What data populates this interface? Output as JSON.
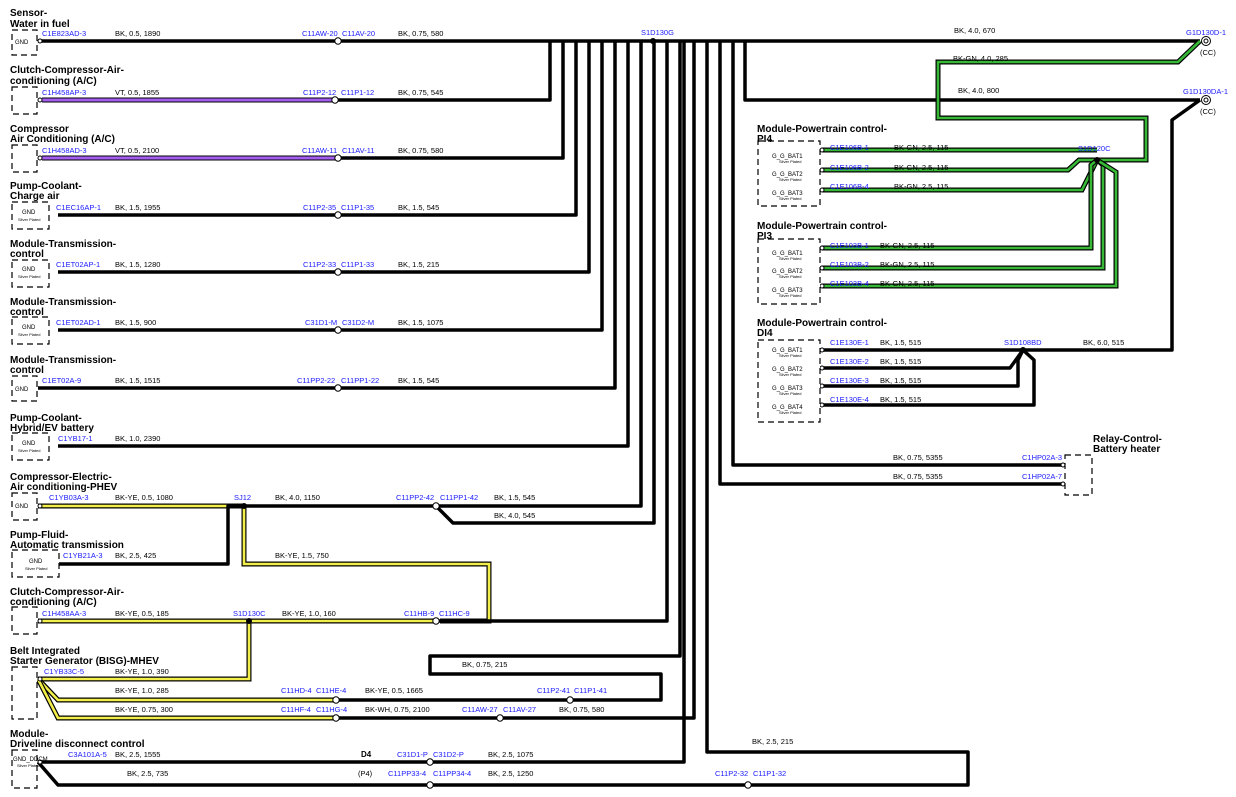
{
  "components": {
    "water_sensor": {
      "l1": "Sensor-",
      "l2": "Water in fuel",
      "ground": "GND",
      "ground_sub": ""
    },
    "clutch_ac_1": {
      "l1": "Clutch-Compressor-Air-",
      "l2": "conditioning (A/C)"
    },
    "compressor_ac": {
      "l1": "Compressor",
      "l2": "Air Conditioning (A/C)"
    },
    "pump_charge": {
      "l1": "Pump-Coolant-",
      "l2": "Charge air",
      "ground": "GND",
      "ground_sub": "Silver Plated"
    },
    "tcm_1": {
      "l1": "Module-Transmission-",
      "l2": "control",
      "ground": "GND",
      "ground_sub": "Silver Plated"
    },
    "tcm_2": {
      "l1": "Module-Transmission-",
      "l2": "control",
      "ground": "GND",
      "ground_sub": "Silver Plated"
    },
    "tcm_3": {
      "l1": "Module-Transmission-",
      "l2": "control",
      "ground": "GND",
      "ground_sub": ""
    },
    "pump_hybrid": {
      "l1": "Pump-Coolant-",
      "l2": "Hybrid/EV battery",
      "ground": "GND",
      "ground_sub": "Silver Plated"
    },
    "comp_phev": {
      "l1": "Compressor-Electric-",
      "l2": "Air conditioning-PHEV",
      "ground": "GND",
      "ground_sub": ""
    },
    "pump_fluid": {
      "l1": "Pump-Fluid-",
      "l2": "Automatic transmission",
      "ground": "GND",
      "ground_sub": "Silver Plated"
    },
    "clutch_ac_2": {
      "l1": "Clutch-Compressor-Air-",
      "l2": "conditioning (A/C)"
    },
    "bisg": {
      "l1": "Belt Integrated",
      "l2": "Starter Generator (BISG)-MHEV"
    },
    "ddcm": {
      "l1": "Module-",
      "l2": "Driveline disconnect control",
      "ground": "GND_DDCM",
      "ground_sub": "Silver Plated"
    },
    "pcm_pi4": {
      "l1": "Module-Powertrain control-",
      "l2": "PI4",
      "pins": [
        "G_G_BAT1",
        "G_G_BAT2",
        "G_G_BAT3"
      ],
      "sub": "Silver Plated"
    },
    "pcm_pi3": {
      "l1": "Module-Powertrain control-",
      "l2": "PI3",
      "pins": [
        "G_G_BAT1",
        "G_G_BAT2",
        "G_G_BAT3"
      ],
      "sub": "Silver Plated"
    },
    "pcm_di4": {
      "l1": "Module-Powertrain control-",
      "l2": "DI4",
      "pins": [
        "G_G_BAT1",
        "G_G_BAT2",
        "G_G_BAT3",
        "G_G_BAT4"
      ],
      "sub": "Silver Plated"
    },
    "relay": {
      "l1": "Relay-Control-",
      "l2": "Battery heater"
    }
  },
  "connectors": {
    "c_water": "C1E823AD-3",
    "c_clutch1": "C1H458AP-3",
    "c_comp": "C1H458AD-3",
    "c_pumpchg": "C1EC16AP-1",
    "c_tcm1": "C1ET02AP-1",
    "c_tcm2": "C1ET02AD-1",
    "c_tcm3": "C1ET02A-9",
    "c_pumphyb": "C1YB17-1",
    "c_phev": "C1YB03A-3",
    "c_fluid": "C1YB21A-3",
    "c_clutch2": "C1H458AA-3",
    "c_bisg": "C1YB33C-5",
    "c_ddcm": "C3A101A-5",
    "i1a": "C11AW-20",
    "i1b": "C11AV-20",
    "i2a": "C11P2-12",
    "i2b": "C11P1-12",
    "i3a": "C11AW-11",
    "i3b": "C11AV-11",
    "i4a": "C11P2-35",
    "i4b": "C11P1-35",
    "i5a": "C11P2-33",
    "i5b": "C11P1-33",
    "i6a": "C31D1-M",
    "i6b": "C31D2-M",
    "i7a": "C11PP2-22",
    "i7b": "C11PP1-22",
    "i9a": "C11PP2-42",
    "i9b": "C11PP1-42",
    "i11a": "C11HB-9",
    "i11b": "C11HC-9",
    "i12a": "C11HD-4",
    "i12b": "C11HE-4",
    "i12c": "C11P2-41",
    "i12d": "C11P1-41",
    "i13a": "C11HF-4",
    "i13b": "C11HG-4",
    "i13c": "C11AW-27",
    "i13d": "C11AV-27",
    "i14a": "C31D1-P",
    "i14b": "C31D2-P",
    "i15a": "C11PP33-4",
    "i15b": "C11PP34-4",
    "i16a": "C11P2-32",
    "i16b": "C11P1-32",
    "s1": "S1D130G",
    "sj12": "SJ12",
    "s130c": "S1D130C",
    "s120c": "S1D120C",
    "s108bd": "S1D108BD",
    "g1": "G1D130D-1",
    "g2": "G1D130DA-1",
    "cc": "(CC)",
    "pi4_1": "C1E106B-1",
    "pi4_2": "C1E106B-2",
    "pi4_3": "C1E106B-4",
    "pi3_1": "C1E103B-1",
    "pi3_2": "C1E103B-2",
    "pi3_3": "C1E103B-4",
    "di4_1": "C1E130E-1",
    "di4_2": "C1E130E-2",
    "di4_3": "C1E130E-3",
    "di4_4": "C1E130E-4",
    "relay_a": "C1HP02A-3",
    "relay_b": "C1HP02A-7"
  },
  "wires": {
    "w1a": "BK,  0.5,  1890",
    "w1b": "BK,  0.75,  580",
    "w2a": "VT,  0.5,  1855",
    "w2b": "BK,  0.75,  545",
    "w3a": "VT,  0.5,  2100",
    "w3b": "BK,  0.75,  580",
    "w4a": "BK,  1.5,  1955",
    "w4b": "BK,  1.5,  545",
    "w5a": "BK,  1.5,  1280",
    "w5b": "BK,  1.5,  215",
    "w6a": "BK,  1.5,  900",
    "w6b": "BK,  1.5,  1075",
    "w7a": "BK,  1.5,  1515",
    "w7b": "BK,  1.5,  545",
    "w8a": "BK,  1.0,  2390",
    "w9a": "BK-YE,  0.5,  1080",
    "w9b": "BK,  4.0,  1150",
    "w9c": "BK,  1.5,  545",
    "w9d": "BK,  4.0,  545",
    "w10a": "BK,  2.5,  425",
    "w10b": "BK-YE,  1.5,  750",
    "w11a": "BK-YE,  0.5,  185",
    "w11b": "BK-YE,  1.0,  160",
    "w12a": "BK-YE,  1.0,  390",
    "w12b": "BK-YE,  1.0,  285",
    "w12c": "BK-YE,  0.5,  1665",
    "w12d": "BK,  0.75,  215",
    "w13a": "BK-YE,  0.75,  300",
    "w13b": "BK-WH,  0.75,  2100",
    "w13c": "BK,  0.75,  580",
    "w14a": "BK,  2.5,  1555",
    "w14b": "BK,  2.5,  1075",
    "w15a": "BK,  2.5,  735",
    "w15b": "BK,  2.5,  1250",
    "w16": "BK,  2.5,  215",
    "wg1": "BK,  4.0,  670",
    "wg2": "BK-GN,  4.0,  285",
    "wg3": "BK,  4.0,  800",
    "wpi4": "BK-GN,  2.5,  115",
    "wpi3": "BK-GN,  2.5,  115",
    "wdi4": "BK,  1.5,  515",
    "wdi4b": "BK,  6.0,  515",
    "wr1": "BK,  0.75,  5355",
    "wr2": "BK,  0.75,  5355",
    "d4": "D4",
    "p4": "(P4)"
  }
}
